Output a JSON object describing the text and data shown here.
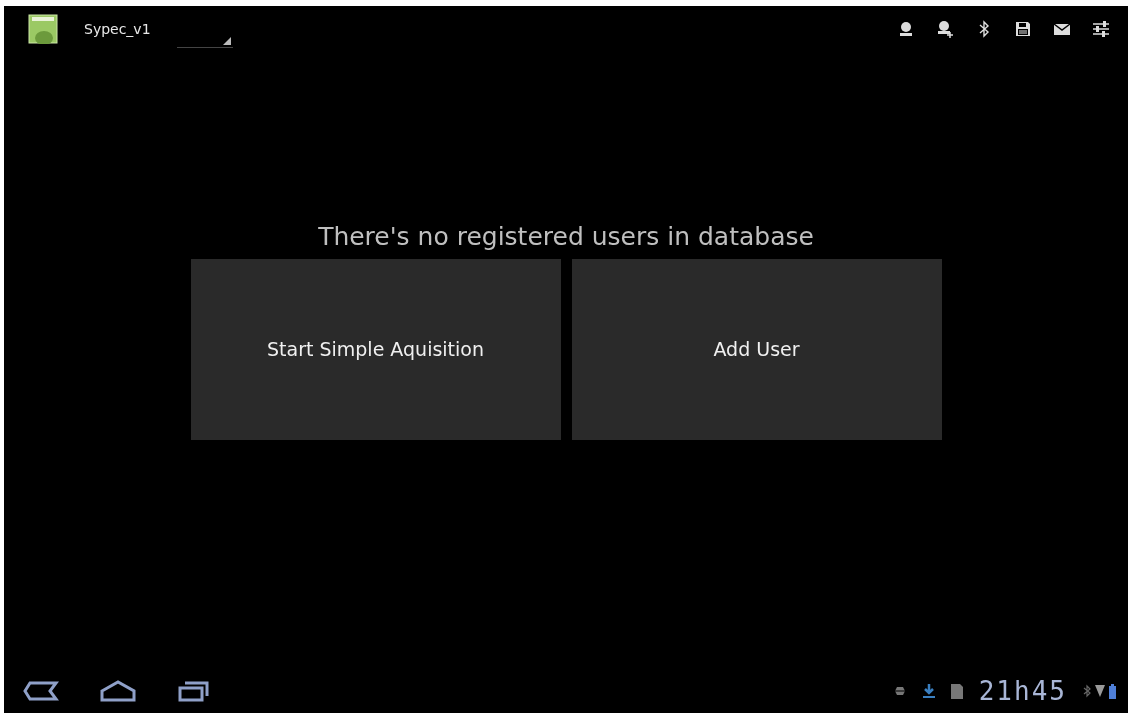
{
  "action_bar": {
    "app_title": "Sypec_v1"
  },
  "message": "There's no registered users in database",
  "buttons": [
    {
      "label": "Start Simple Aquisition"
    },
    {
      "label": "Add User"
    }
  ],
  "status_bar": {
    "clock": "21h45"
  }
}
